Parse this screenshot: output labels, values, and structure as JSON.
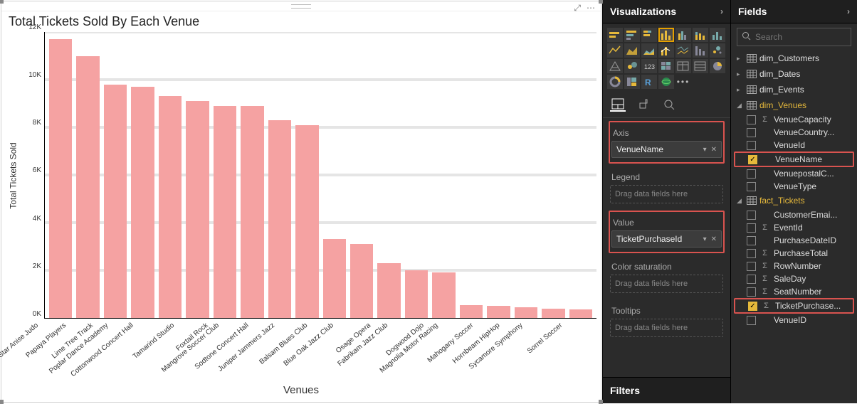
{
  "chart_data": {
    "type": "bar",
    "title": "Total Tickets Sold By Each Venue",
    "xlabel": "Venues",
    "ylabel": "Total Tickets Sold",
    "ylim": [
      0,
      12000
    ],
    "yticks": [
      "12K",
      "10K",
      "8K",
      "6K",
      "4K",
      "2K",
      "0K"
    ],
    "categories": [
      "Star Anise Judo",
      "Papaya Players",
      "Lime Tree Track",
      "Poplar Dance Academy",
      "Cottonwood Concert Hall",
      "Tamarind Studio",
      "Foxtail Rock",
      "Mangrove Soccer Club",
      "Sodtone Concert Hall",
      "Juniper Jammers Jazz",
      "Balsam Blues Club",
      "Blue Oak Jazz Club",
      "Osage Opera",
      "Fabrikam Jazz Club",
      "Dogwood Dojo",
      "Magnolia Motor Racing",
      "Mahogany Soccer",
      "Hornbeam HipHop",
      "Sycamore Symphony",
      "Sorrel Soccer"
    ],
    "values": [
      11700,
      11000,
      9800,
      9700,
      9300,
      9100,
      8900,
      8900,
      8300,
      8100,
      3300,
      3100,
      2300,
      2000,
      1900,
      550,
      500,
      450,
      380,
      350
    ]
  },
  "viz": {
    "header": "Visualizations",
    "axis_label": "Axis",
    "axis_field": "VenueName",
    "legend_label": "Legend",
    "value_label": "Value",
    "value_field": "TicketPurchaseId",
    "sat_label": "Color saturation",
    "tooltips_label": "Tooltips",
    "drag_hint": "Drag data fields here",
    "filters_header": "Filters"
  },
  "fields": {
    "header": "Fields",
    "search_placeholder": "Search",
    "tables": [
      {
        "name": "dim_Customers",
        "open": false,
        "fields": []
      },
      {
        "name": "dim_Dates",
        "open": false,
        "fields": []
      },
      {
        "name": "dim_Events",
        "open": false,
        "fields": []
      },
      {
        "name": "dim_Venues",
        "open": true,
        "hl": true,
        "fields": [
          {
            "name": "VenueCapacity",
            "sigma": true
          },
          {
            "name": "VenueCountry...",
            "sigma": false
          },
          {
            "name": "VenueId",
            "sigma": false
          },
          {
            "name": "VenueName",
            "sigma": false,
            "checked": true,
            "hl": true
          },
          {
            "name": "VenuepostalC...",
            "sigma": false
          },
          {
            "name": "VenueType",
            "sigma": false
          }
        ]
      },
      {
        "name": "fact_Tickets",
        "open": true,
        "hl": true,
        "fields": [
          {
            "name": "CustomerEmai...",
            "sigma": false
          },
          {
            "name": "EventId",
            "sigma": true
          },
          {
            "name": "PurchaseDateID",
            "sigma": false
          },
          {
            "name": "PurchaseTotal",
            "sigma": true
          },
          {
            "name": "RowNumber",
            "sigma": true
          },
          {
            "name": "SaleDay",
            "sigma": true
          },
          {
            "name": "SeatNumber",
            "sigma": true
          },
          {
            "name": "TicketPurchase...",
            "sigma": true,
            "checked": true,
            "hl": true
          },
          {
            "name": "VenueID",
            "sigma": false
          }
        ]
      }
    ]
  }
}
